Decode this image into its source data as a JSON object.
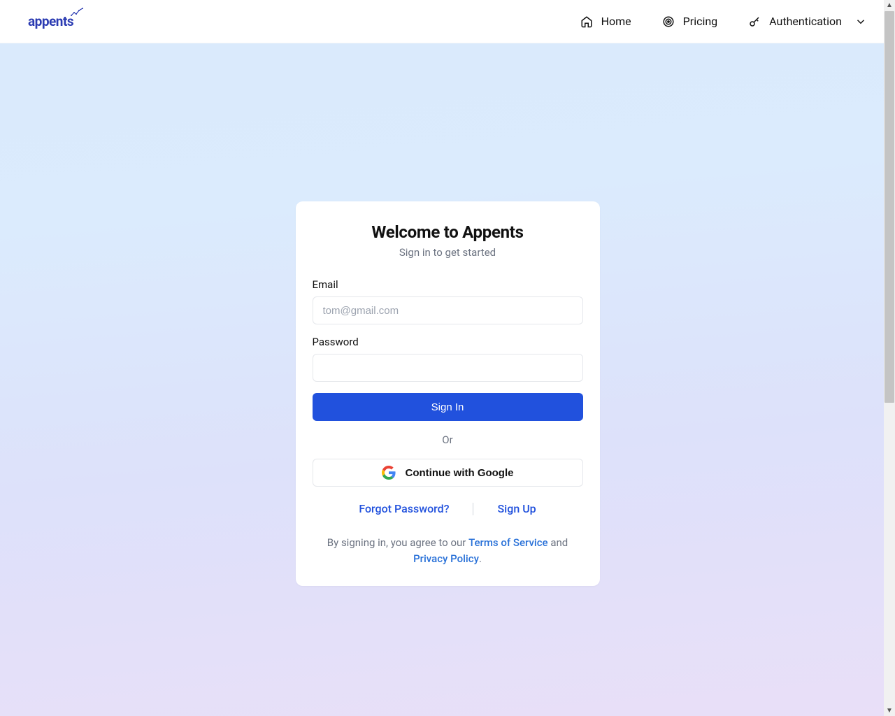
{
  "brand": {
    "name": "appents"
  },
  "nav": {
    "home": "Home",
    "pricing": "Pricing",
    "auth": "Authentication"
  },
  "card": {
    "title": "Welcome to Appents",
    "subtitle": "Sign in to get started",
    "email_label": "Email",
    "email_placeholder": "tom@gmail.com",
    "password_label": "Password",
    "signin": "Sign In",
    "or": "Or",
    "google": "Continue with Google",
    "forgot": "Forgot Password?",
    "signup": "Sign Up",
    "legal_prefix": "By signing in, you agree to our ",
    "legal_tos": "Terms of Service",
    "legal_mid": " and ",
    "legal_privacy": "Privacy Policy",
    "legal_suffix": "."
  }
}
